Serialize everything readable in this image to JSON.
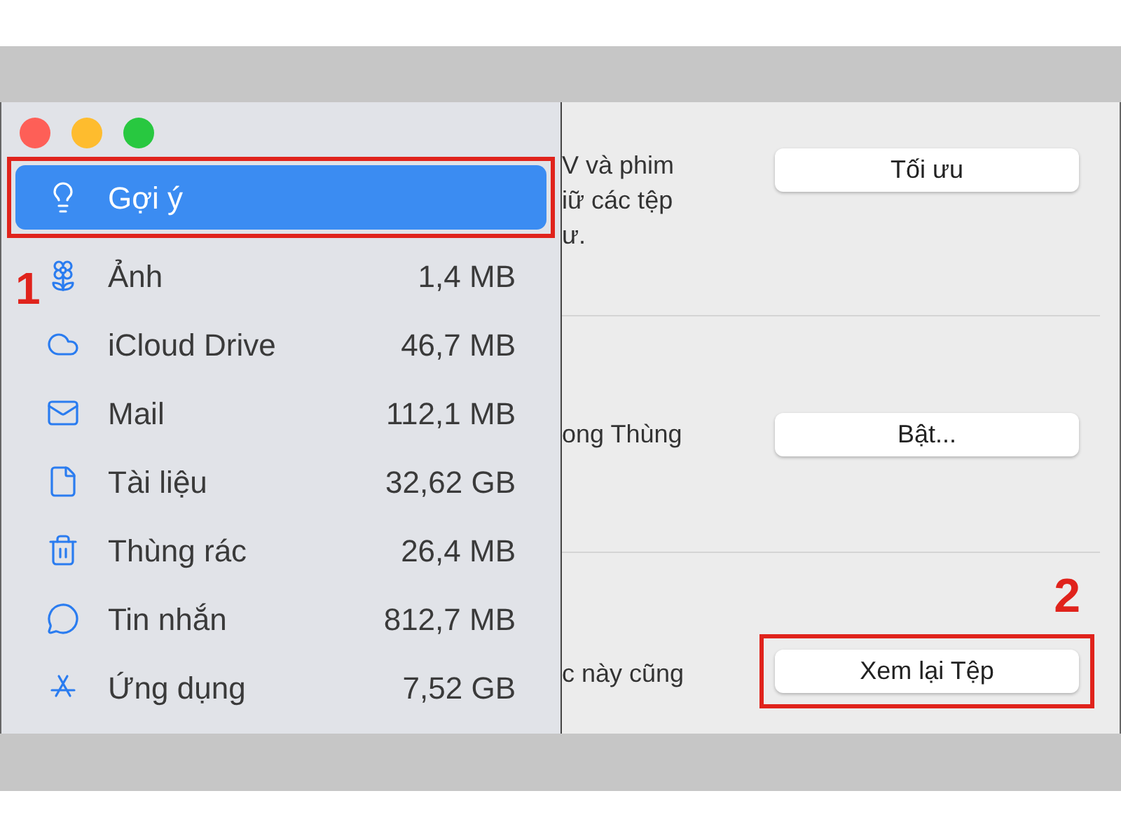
{
  "sidebar": {
    "items": [
      {
        "kind": "suggestions",
        "label": "Gợi ý",
        "selected": true,
        "highlighted": true
      },
      {
        "kind": "photos",
        "label": "Ảnh",
        "size": "1,4 MB",
        "selected": false,
        "highlighted": false
      },
      {
        "kind": "cloud",
        "label": "iCloud Drive",
        "size": "46,7 MB",
        "selected": false,
        "highlighted": false
      },
      {
        "kind": "mail",
        "label": "Mail",
        "size": "112,1 MB",
        "selected": false,
        "highlighted": false
      },
      {
        "kind": "document",
        "label": "Tài liệu",
        "size": "32,62 GB",
        "selected": false,
        "highlighted": false
      },
      {
        "kind": "trash",
        "label": "Thùng rác",
        "size": "26,4 MB",
        "selected": false,
        "highlighted": false
      },
      {
        "kind": "messages",
        "label": "Tin nhắn",
        "size": "812,7 MB",
        "selected": false,
        "highlighted": false
      },
      {
        "kind": "apps",
        "label": "Ứng dụng",
        "size": "7,52 GB",
        "selected": false,
        "highlighted": false
      }
    ]
  },
  "sections": [
    {
      "lines": [
        "V và phim",
        "iữ các tệp",
        "ư."
      ],
      "button": "Tối ưu",
      "highlighted": false
    },
    {
      "lines": [
        "ong Thùng"
      ],
      "button": "Bật...",
      "highlighted": false
    },
    {
      "lines": [
        "c này cũng"
      ],
      "button": "Xem lại Tệp",
      "highlighted": true
    }
  ],
  "annotations": [
    "1",
    "2"
  ]
}
